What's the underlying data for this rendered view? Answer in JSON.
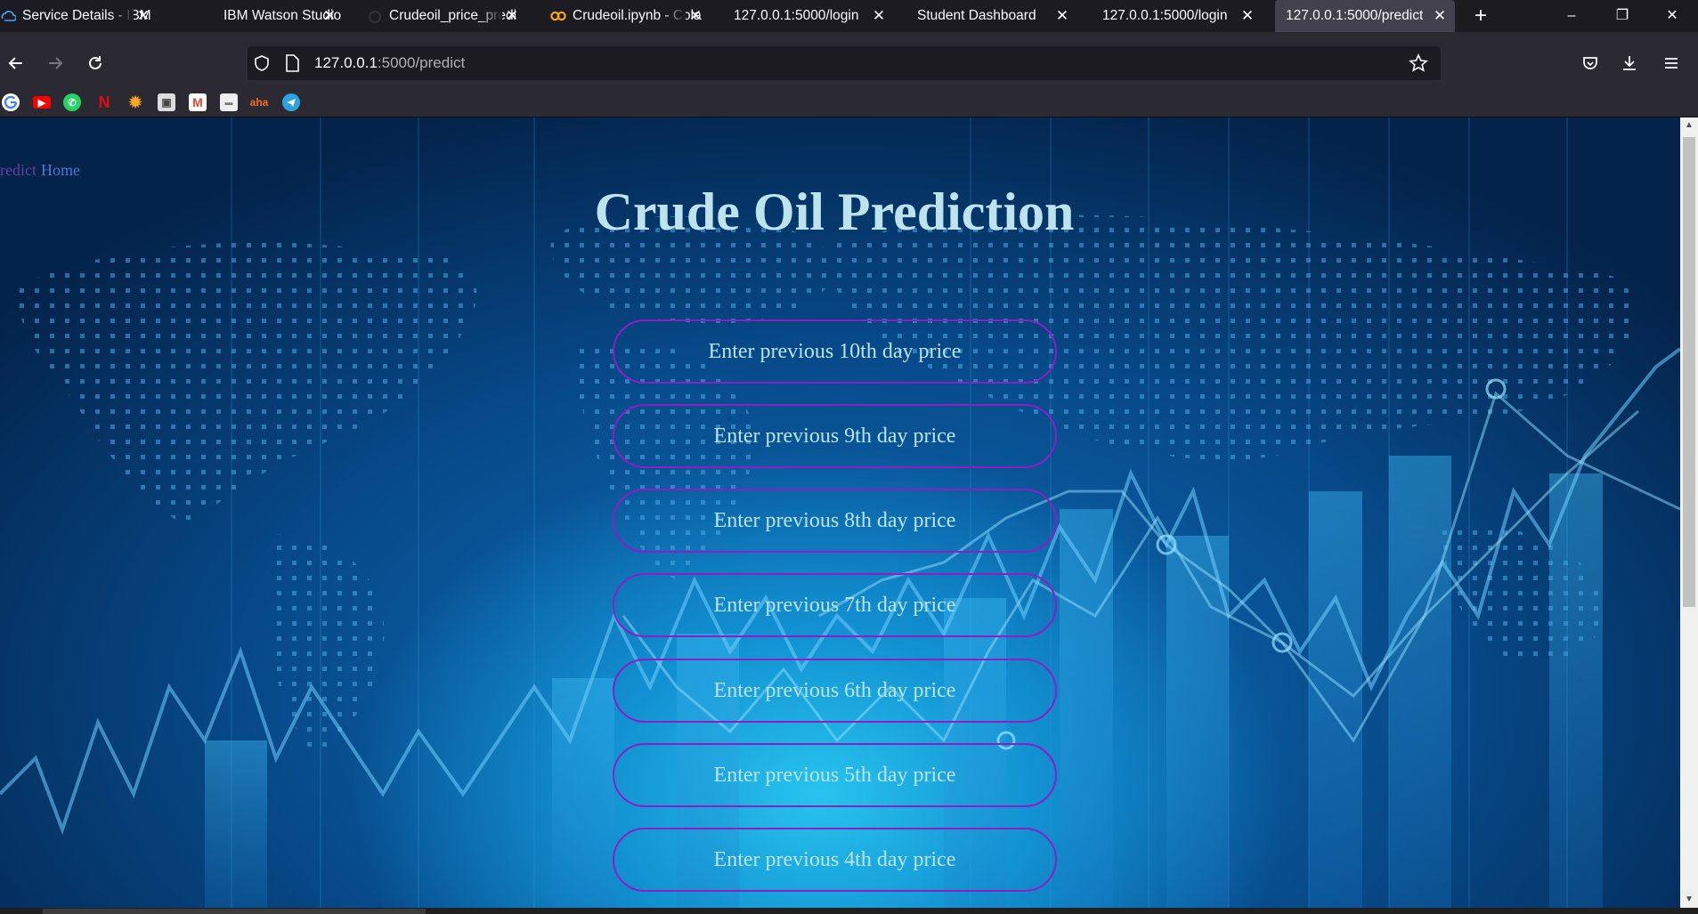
{
  "browser": {
    "tabs": [
      {
        "title": "Service Details - IBM",
        "icon": "ibm-cloud-icon"
      },
      {
        "title": "IBM Watson Studio",
        "icon": "watson-icon"
      },
      {
        "title": "Crudeoil_price_predi",
        "icon": "watson-icon"
      },
      {
        "title": "Crudeoil.ipynb - Cola",
        "icon": "colab-icon"
      },
      {
        "title": "127.0.0.1:5000/login",
        "icon": "none"
      },
      {
        "title": "Student Dashboard",
        "icon": "none"
      },
      {
        "title": "127.0.0.1:5000/login",
        "icon": "none"
      },
      {
        "title": "127.0.0.1:5000/predict",
        "icon": "none",
        "active": true
      }
    ],
    "url_host": "127.0.0.1",
    "url_path": ":5000/predict",
    "bookmarks": [
      "google-icon",
      "youtube-icon",
      "whatsapp-icon",
      "netflix-icon",
      "sun-icon",
      "photo-icon",
      "gmail-icon",
      "site-icon",
      "aha-icon",
      "telegram-icon"
    ],
    "bookmark_text": {
      "aha": "aha"
    }
  },
  "page": {
    "nav": {
      "predict": "redict",
      "home": "Home"
    },
    "title": "Crude Oil Prediction",
    "fields": [
      {
        "placeholder": "Enter previous 10th day price"
      },
      {
        "placeholder": "Enter previous 9th day price"
      },
      {
        "placeholder": "Enter previous 8th day price"
      },
      {
        "placeholder": "Enter previous 7th day price"
      },
      {
        "placeholder": "Enter previous 6th day price"
      },
      {
        "placeholder": "Enter previous 5th day price"
      },
      {
        "placeholder": "Enter previous 4th day price"
      }
    ]
  },
  "colors": {
    "field_border": "#8c1ec4",
    "title": "#bde4ee",
    "predict_link": "#6a3fa0",
    "home_link": "#4a78d8"
  }
}
